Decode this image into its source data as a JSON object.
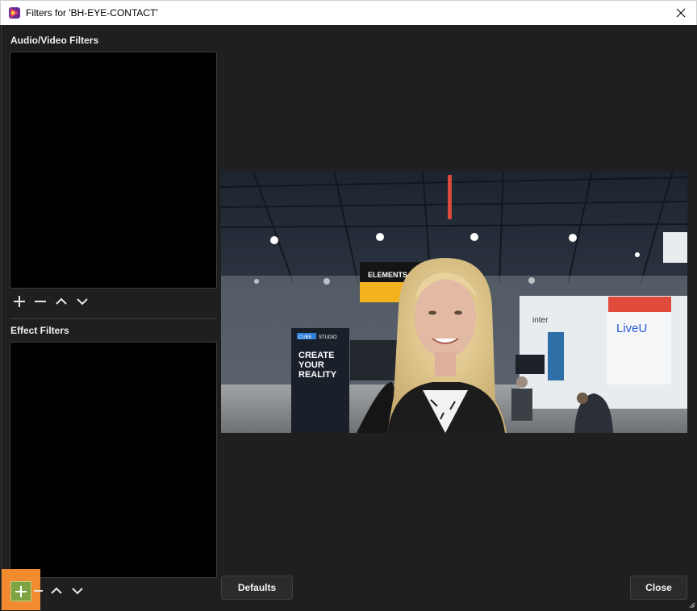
{
  "window": {
    "title": "Filters for 'BH-EYE-CONTACT'",
    "app_icon": "obs-app-icon",
    "close_icon": "close-icon"
  },
  "audio_video": {
    "label": "Audio/Video Filters",
    "buttons": [
      "add-icon",
      "remove-icon",
      "move-up-icon",
      "move-down-icon"
    ]
  },
  "effect": {
    "label": "Effect Filters",
    "buttons": [
      "add-icon",
      "remove-icon",
      "move-up-icon",
      "move-down-icon"
    ]
  },
  "preview": {
    "booth_sign": "ELEMENTS",
    "stand_brand": "LiveU",
    "stand_partial": "inter",
    "poster_brand_a": "CUBE",
    "poster_brand_b": "STUDIO",
    "poster_line1": "CREATE",
    "poster_line2": "YOUR",
    "poster_line3": "REALITY"
  },
  "footer": {
    "defaults_label": "Defaults",
    "close_label": "Close"
  },
  "colors": {
    "background": "#1f1f1f",
    "list_background": "#000000",
    "highlight": "#f28a30",
    "add_button_active": "#7da342"
  }
}
